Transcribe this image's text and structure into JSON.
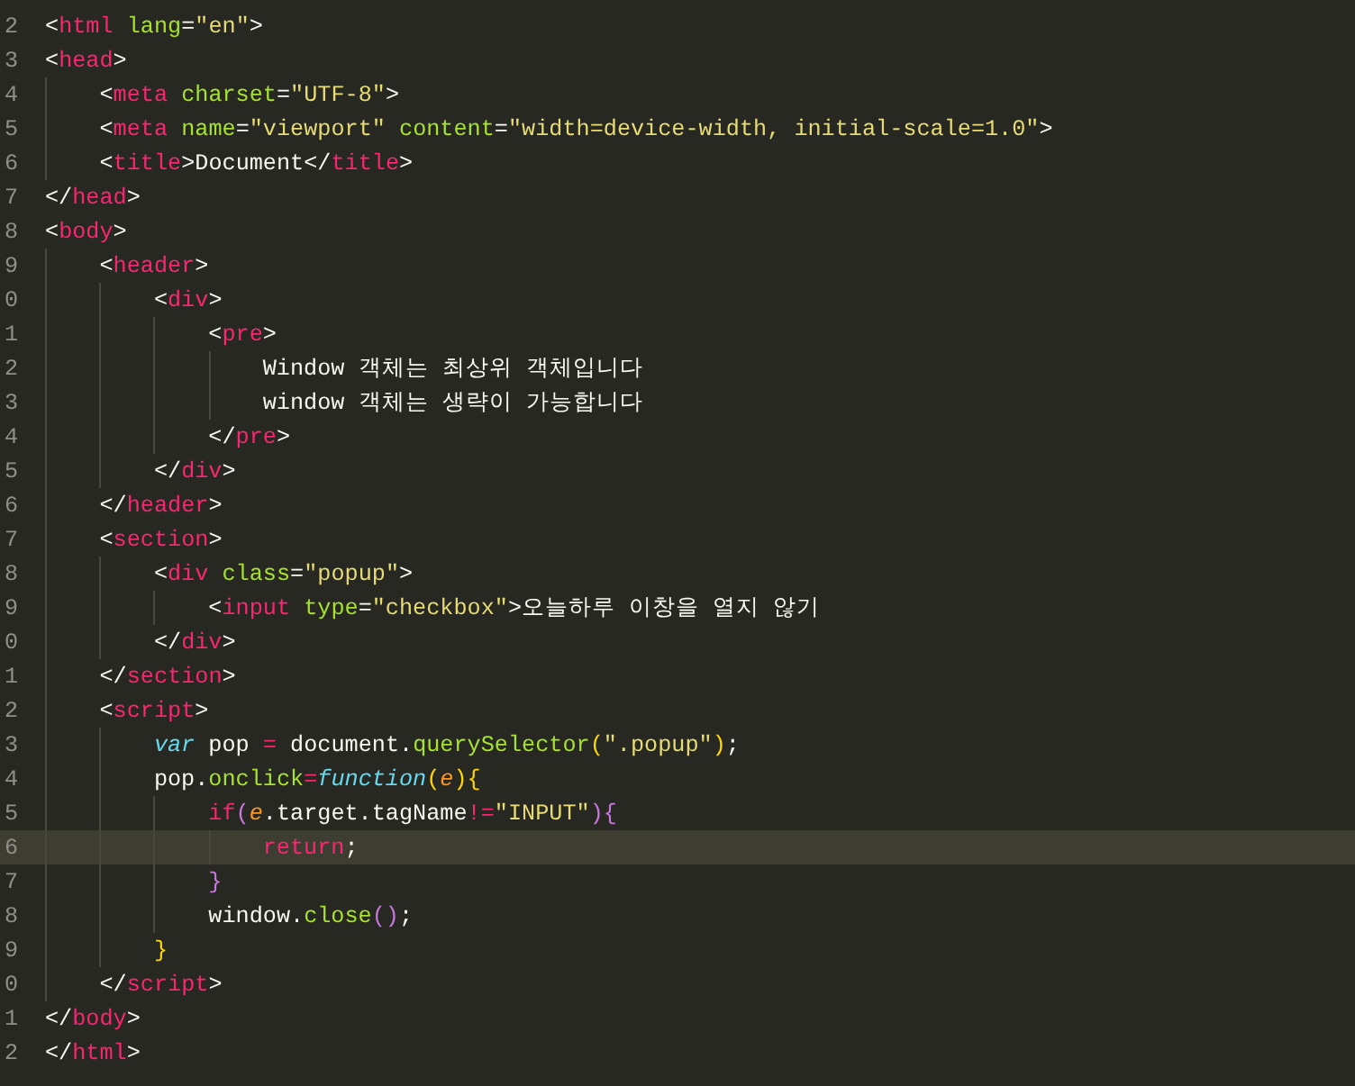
{
  "editor": {
    "lines": [
      {
        "number": "2",
        "current": false,
        "tokens": [
          {
            "kind": "punct",
            "text": "<"
          },
          {
            "kind": "tag",
            "text": "html"
          },
          {
            "kind": "attr",
            "text": " lang"
          },
          {
            "kind": "punct",
            "text": "="
          },
          {
            "kind": "str",
            "text": "\"en\""
          },
          {
            "kind": "punct",
            "text": ">"
          }
        ]
      },
      {
        "number": "3",
        "current": false,
        "tokens": [
          {
            "kind": "punct",
            "text": "<"
          },
          {
            "kind": "tag",
            "text": "head"
          },
          {
            "kind": "punct",
            "text": ">"
          }
        ],
        "children": [
          {
            "number": "4",
            "current": false,
            "tokens": [
              {
                "kind": "punct",
                "text": "<"
              },
              {
                "kind": "tag",
                "text": "meta"
              },
              {
                "kind": "attr",
                "text": " charset"
              },
              {
                "kind": "punct",
                "text": "="
              },
              {
                "kind": "str",
                "text": "\"UTF-8\""
              },
              {
                "kind": "punct",
                "text": ">"
              }
            ]
          },
          {
            "number": "5",
            "current": false,
            "tokens": [
              {
                "kind": "punct",
                "text": "<"
              },
              {
                "kind": "tag",
                "text": "meta"
              },
              {
                "kind": "attr",
                "text": " name"
              },
              {
                "kind": "punct",
                "text": "="
              },
              {
                "kind": "str",
                "text": "\"viewport\""
              },
              {
                "kind": "attr",
                "text": " content"
              },
              {
                "kind": "punct",
                "text": "="
              },
              {
                "kind": "str",
                "text": "\"width=device-width, initial-scale=1.0\""
              },
              {
                "kind": "punct",
                "text": ">"
              }
            ]
          },
          {
            "number": "6",
            "current": false,
            "tokens": [
              {
                "kind": "punct",
                "text": "<"
              },
              {
                "kind": "tag",
                "text": "title"
              },
              {
                "kind": "punct",
                "text": ">"
              },
              {
                "kind": "plain",
                "text": "Document"
              },
              {
                "kind": "punct",
                "text": "</"
              },
              {
                "kind": "tag",
                "text": "title"
              },
              {
                "kind": "punct",
                "text": ">"
              }
            ]
          }
        ]
      },
      {
        "number": "7",
        "current": false,
        "tokens": [
          {
            "kind": "punct",
            "text": "</"
          },
          {
            "kind": "tag",
            "text": "head"
          },
          {
            "kind": "punct",
            "text": ">"
          }
        ]
      },
      {
        "number": "8",
        "current": false,
        "tokens": [
          {
            "kind": "punct",
            "text": "<"
          },
          {
            "kind": "tag",
            "text": "body"
          },
          {
            "kind": "punct",
            "text": ">"
          }
        ],
        "children": [
          {
            "number": "9",
            "current": false,
            "tokens": [
              {
                "kind": "punct",
                "text": "<"
              },
              {
                "kind": "tag",
                "text": "header"
              },
              {
                "kind": "punct",
                "text": ">"
              }
            ],
            "children": [
              {
                "number": "0",
                "current": false,
                "tokens": [
                  {
                    "kind": "punct",
                    "text": "<"
                  },
                  {
                    "kind": "tag",
                    "text": "div"
                  },
                  {
                    "kind": "punct",
                    "text": ">"
                  }
                ],
                "children": [
                  {
                    "number": "1",
                    "current": false,
                    "tokens": [
                      {
                        "kind": "punct",
                        "text": "<"
                      },
                      {
                        "kind": "tag",
                        "text": "pre"
                      },
                      {
                        "kind": "punct",
                        "text": ">"
                      }
                    ],
                    "children": [
                      {
                        "number": "2",
                        "current": false,
                        "tokens": [
                          {
                            "kind": "plain",
                            "text": "Window 객체는 최상위 객체입니다"
                          }
                        ]
                      },
                      {
                        "number": "3",
                        "current": false,
                        "tokens": [
                          {
                            "kind": "plain",
                            "text": "window 객체는 생략이 가능합니다"
                          }
                        ]
                      }
                    ]
                  },
                  {
                    "number": "4",
                    "current": false,
                    "tokens": [
                      {
                        "kind": "punct",
                        "text": "</"
                      },
                      {
                        "kind": "tag",
                        "text": "pre"
                      },
                      {
                        "kind": "punct",
                        "text": ">"
                      }
                    ]
                  }
                ]
              },
              {
                "number": "5",
                "current": false,
                "tokens": [
                  {
                    "kind": "punct",
                    "text": "</"
                  },
                  {
                    "kind": "tag",
                    "text": "div"
                  },
                  {
                    "kind": "punct",
                    "text": ">"
                  }
                ]
              }
            ]
          },
          {
            "number": "6",
            "current": false,
            "tokens": [
              {
                "kind": "punct",
                "text": "</"
              },
              {
                "kind": "tag",
                "text": "header"
              },
              {
                "kind": "punct",
                "text": ">"
              }
            ]
          },
          {
            "number": "7",
            "current": false,
            "tokens": [
              {
                "kind": "punct",
                "text": "<"
              },
              {
                "kind": "tag",
                "text": "section"
              },
              {
                "kind": "punct",
                "text": ">"
              }
            ],
            "children": [
              {
                "number": "8",
                "current": false,
                "tokens": [
                  {
                    "kind": "punct",
                    "text": "<"
                  },
                  {
                    "kind": "tag",
                    "text": "div"
                  },
                  {
                    "kind": "attr",
                    "text": " class"
                  },
                  {
                    "kind": "punct",
                    "text": "="
                  },
                  {
                    "kind": "str",
                    "text": "\"popup\""
                  },
                  {
                    "kind": "punct",
                    "text": ">"
                  }
                ],
                "children": [
                  {
                    "number": "9",
                    "current": false,
                    "tokens": [
                      {
                        "kind": "punct",
                        "text": "<"
                      },
                      {
                        "kind": "tag",
                        "text": "input"
                      },
                      {
                        "kind": "attr",
                        "text": " type"
                      },
                      {
                        "kind": "punct",
                        "text": "="
                      },
                      {
                        "kind": "str",
                        "text": "\"checkbox\""
                      },
                      {
                        "kind": "punct",
                        "text": ">"
                      },
                      {
                        "kind": "plain",
                        "text": "오늘하루 이창을 열지 않기"
                      }
                    ]
                  }
                ]
              },
              {
                "number": "0",
                "current": false,
                "tokens": [
                  {
                    "kind": "punct",
                    "text": "</"
                  },
                  {
                    "kind": "tag",
                    "text": "div"
                  },
                  {
                    "kind": "punct",
                    "text": ">"
                  }
                ]
              }
            ]
          },
          {
            "number": "1",
            "current": false,
            "tokens": [
              {
                "kind": "punct",
                "text": "</"
              },
              {
                "kind": "tag",
                "text": "section"
              },
              {
                "kind": "punct",
                "text": ">"
              }
            ]
          },
          {
            "number": "2",
            "current": false,
            "tokens": [
              {
                "kind": "punct",
                "text": "<"
              },
              {
                "kind": "tag",
                "text": "script"
              },
              {
                "kind": "punct",
                "text": ">"
              }
            ],
            "children": [
              {
                "number": "3",
                "current": false,
                "tokens": [
                  {
                    "kind": "keyword",
                    "text": "var"
                  },
                  {
                    "kind": "plain",
                    "text": " pop "
                  },
                  {
                    "kind": "op",
                    "text": "="
                  },
                  {
                    "kind": "plain",
                    "text": " document."
                  },
                  {
                    "kind": "func",
                    "text": "querySelector"
                  },
                  {
                    "kind": "bracket",
                    "text": "("
                  },
                  {
                    "kind": "str",
                    "text": "\".popup\""
                  },
                  {
                    "kind": "bracket",
                    "text": ")"
                  },
                  {
                    "kind": "plain",
                    "text": ";"
                  }
                ]
              },
              {
                "number": "4",
                "current": false,
                "tokens": [
                  {
                    "kind": "plain",
                    "text": "pop."
                  },
                  {
                    "kind": "func",
                    "text": "onclick"
                  },
                  {
                    "kind": "op",
                    "text": "="
                  },
                  {
                    "kind": "keyword",
                    "text": "function"
                  },
                  {
                    "kind": "bracket",
                    "text": "("
                  },
                  {
                    "kind": "param",
                    "text": "e"
                  },
                  {
                    "kind": "bracket",
                    "text": ")"
                  },
                  {
                    "kind": "bracket",
                    "text": "{"
                  }
                ],
                "children": [
                  {
                    "number": "5",
                    "current": false,
                    "tokens": [
                      {
                        "kind": "op",
                        "text": "if"
                      },
                      {
                        "kind": "bracket2",
                        "text": "("
                      },
                      {
                        "kind": "param",
                        "text": "e"
                      },
                      {
                        "kind": "plain",
                        "text": ".target.tagName"
                      },
                      {
                        "kind": "op",
                        "text": "!="
                      },
                      {
                        "kind": "str",
                        "text": "\"INPUT\""
                      },
                      {
                        "kind": "bracket2",
                        "text": "){"
                      }
                    ],
                    "children": [
                      {
                        "number": "6",
                        "current": true,
                        "tokens": [
                          {
                            "kind": "op",
                            "text": "return"
                          },
                          {
                            "kind": "plain",
                            "text": ";"
                          }
                        ]
                      }
                    ]
                  },
                  {
                    "number": "7",
                    "current": false,
                    "tokens": [
                      {
                        "kind": "bracket2",
                        "text": "}"
                      }
                    ]
                  },
                  {
                    "number": "8",
                    "current": false,
                    "tokens": [
                      {
                        "kind": "plain",
                        "text": "window."
                      },
                      {
                        "kind": "func",
                        "text": "close"
                      },
                      {
                        "kind": "bracket2",
                        "text": "()"
                      },
                      {
                        "kind": "plain",
                        "text": ";"
                      }
                    ]
                  }
                ]
              },
              {
                "number": "9",
                "current": false,
                "tokens": [
                  {
                    "kind": "bracket",
                    "text": "}"
                  }
                ]
              }
            ]
          },
          {
            "number": "0",
            "current": false,
            "tokens": [
              {
                "kind": "punct",
                "text": "</"
              },
              {
                "kind": "tag",
                "text": "script"
              },
              {
                "kind": "punct",
                "text": ">"
              }
            ]
          }
        ]
      },
      {
        "number": "1",
        "current": false,
        "tokens": [
          {
            "kind": "punct",
            "text": "</"
          },
          {
            "kind": "tag",
            "text": "body"
          },
          {
            "kind": "punct",
            "text": ">"
          }
        ]
      },
      {
        "number": "2",
        "current": false,
        "tokens": [
          {
            "kind": "punct",
            "text": "</"
          },
          {
            "kind": "tag",
            "text": "html"
          },
          {
            "kind": "punct",
            "text": ">"
          }
        ]
      }
    ]
  }
}
